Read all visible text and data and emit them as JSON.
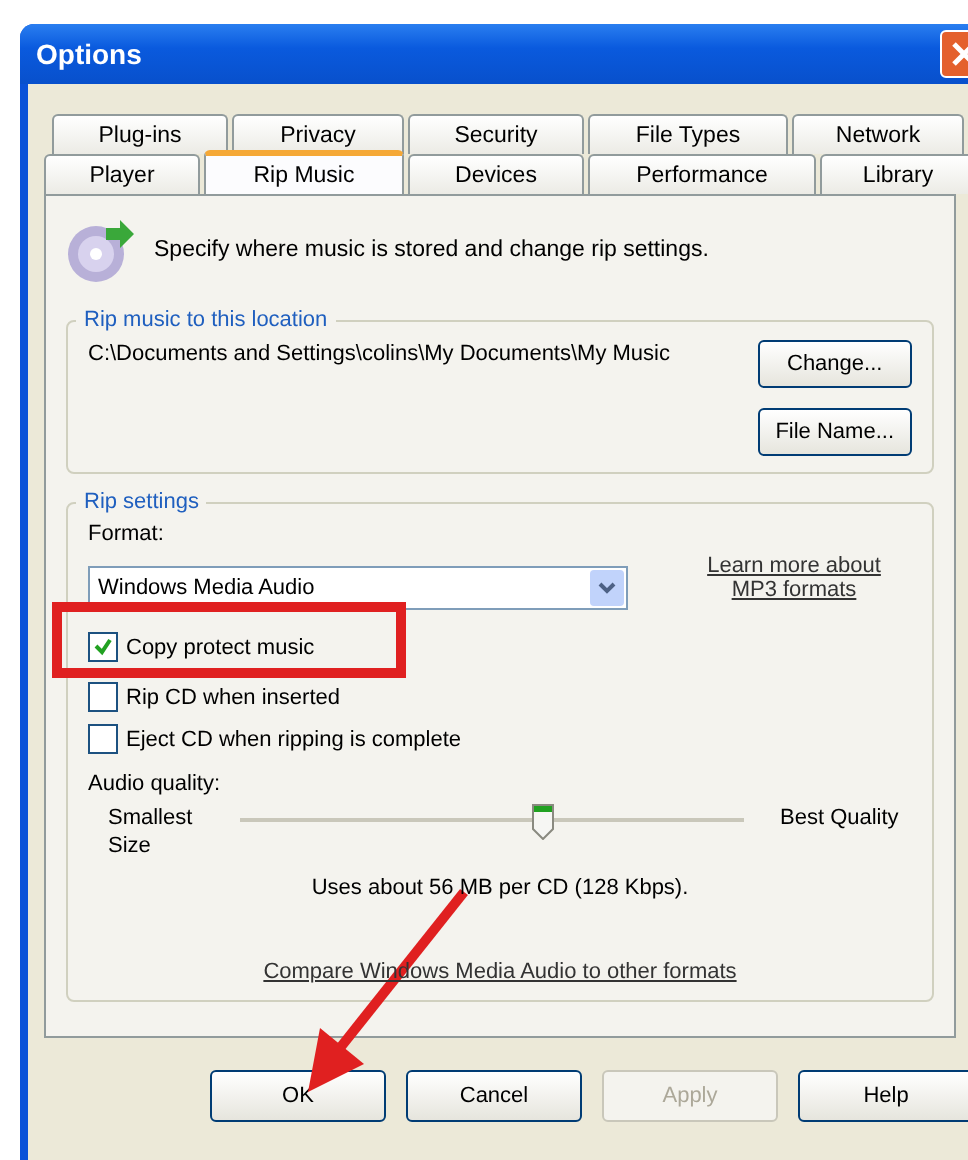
{
  "window": {
    "title": "Options"
  },
  "tab_rows": [
    {
      "tabs": [
        {
          "label": "Plug-ins",
          "selected": false
        },
        {
          "label": "Privacy",
          "selected": false
        },
        {
          "label": "Security",
          "selected": false
        },
        {
          "label": "File Types",
          "selected": false
        },
        {
          "label": "Network",
          "selected": false
        }
      ]
    },
    {
      "tabs": [
        {
          "label": "Player",
          "selected": false
        },
        {
          "label": "Rip Music",
          "selected": true
        },
        {
          "label": "Devices",
          "selected": false
        },
        {
          "label": "Performance",
          "selected": false
        },
        {
          "label": "Library",
          "selected": false
        }
      ]
    }
  ],
  "header": {
    "text": "Specify where music is stored and change rip settings."
  },
  "location_group": {
    "title": "Rip music to this location",
    "path": "C:\\Documents and Settings\\colins\\My Documents\\My Music",
    "buttons": [
      {
        "label": "Change...",
        "disabled": false
      },
      {
        "label": "File Name...",
        "disabled": false
      }
    ]
  },
  "settings_group": {
    "title": "Rip settings",
    "format_label": "Format:",
    "format_value": "Windows Media Audio",
    "format_link": "Learn more about MP3 formats",
    "checkboxes": [
      {
        "label": "Copy protect music",
        "checked": true
      },
      {
        "label": "Rip CD when inserted",
        "checked": false
      },
      {
        "label": "Eject CD when ripping is complete",
        "checked": false
      }
    ],
    "quality_label": "Audio quality:",
    "slider": {
      "min_label": "Smallest Size",
      "max_label": "Best Quality",
      "level": 0.6
    },
    "usage": "Uses about 56 MB per CD (128 Kbps).",
    "compare_link": "Compare Windows Media Audio to other formats"
  },
  "buttons": [
    {
      "label": "OK",
      "disabled": false
    },
    {
      "label": "Cancel",
      "disabled": false
    },
    {
      "label": "Apply",
      "disabled": true
    },
    {
      "label": "Help",
      "disabled": false
    }
  ]
}
